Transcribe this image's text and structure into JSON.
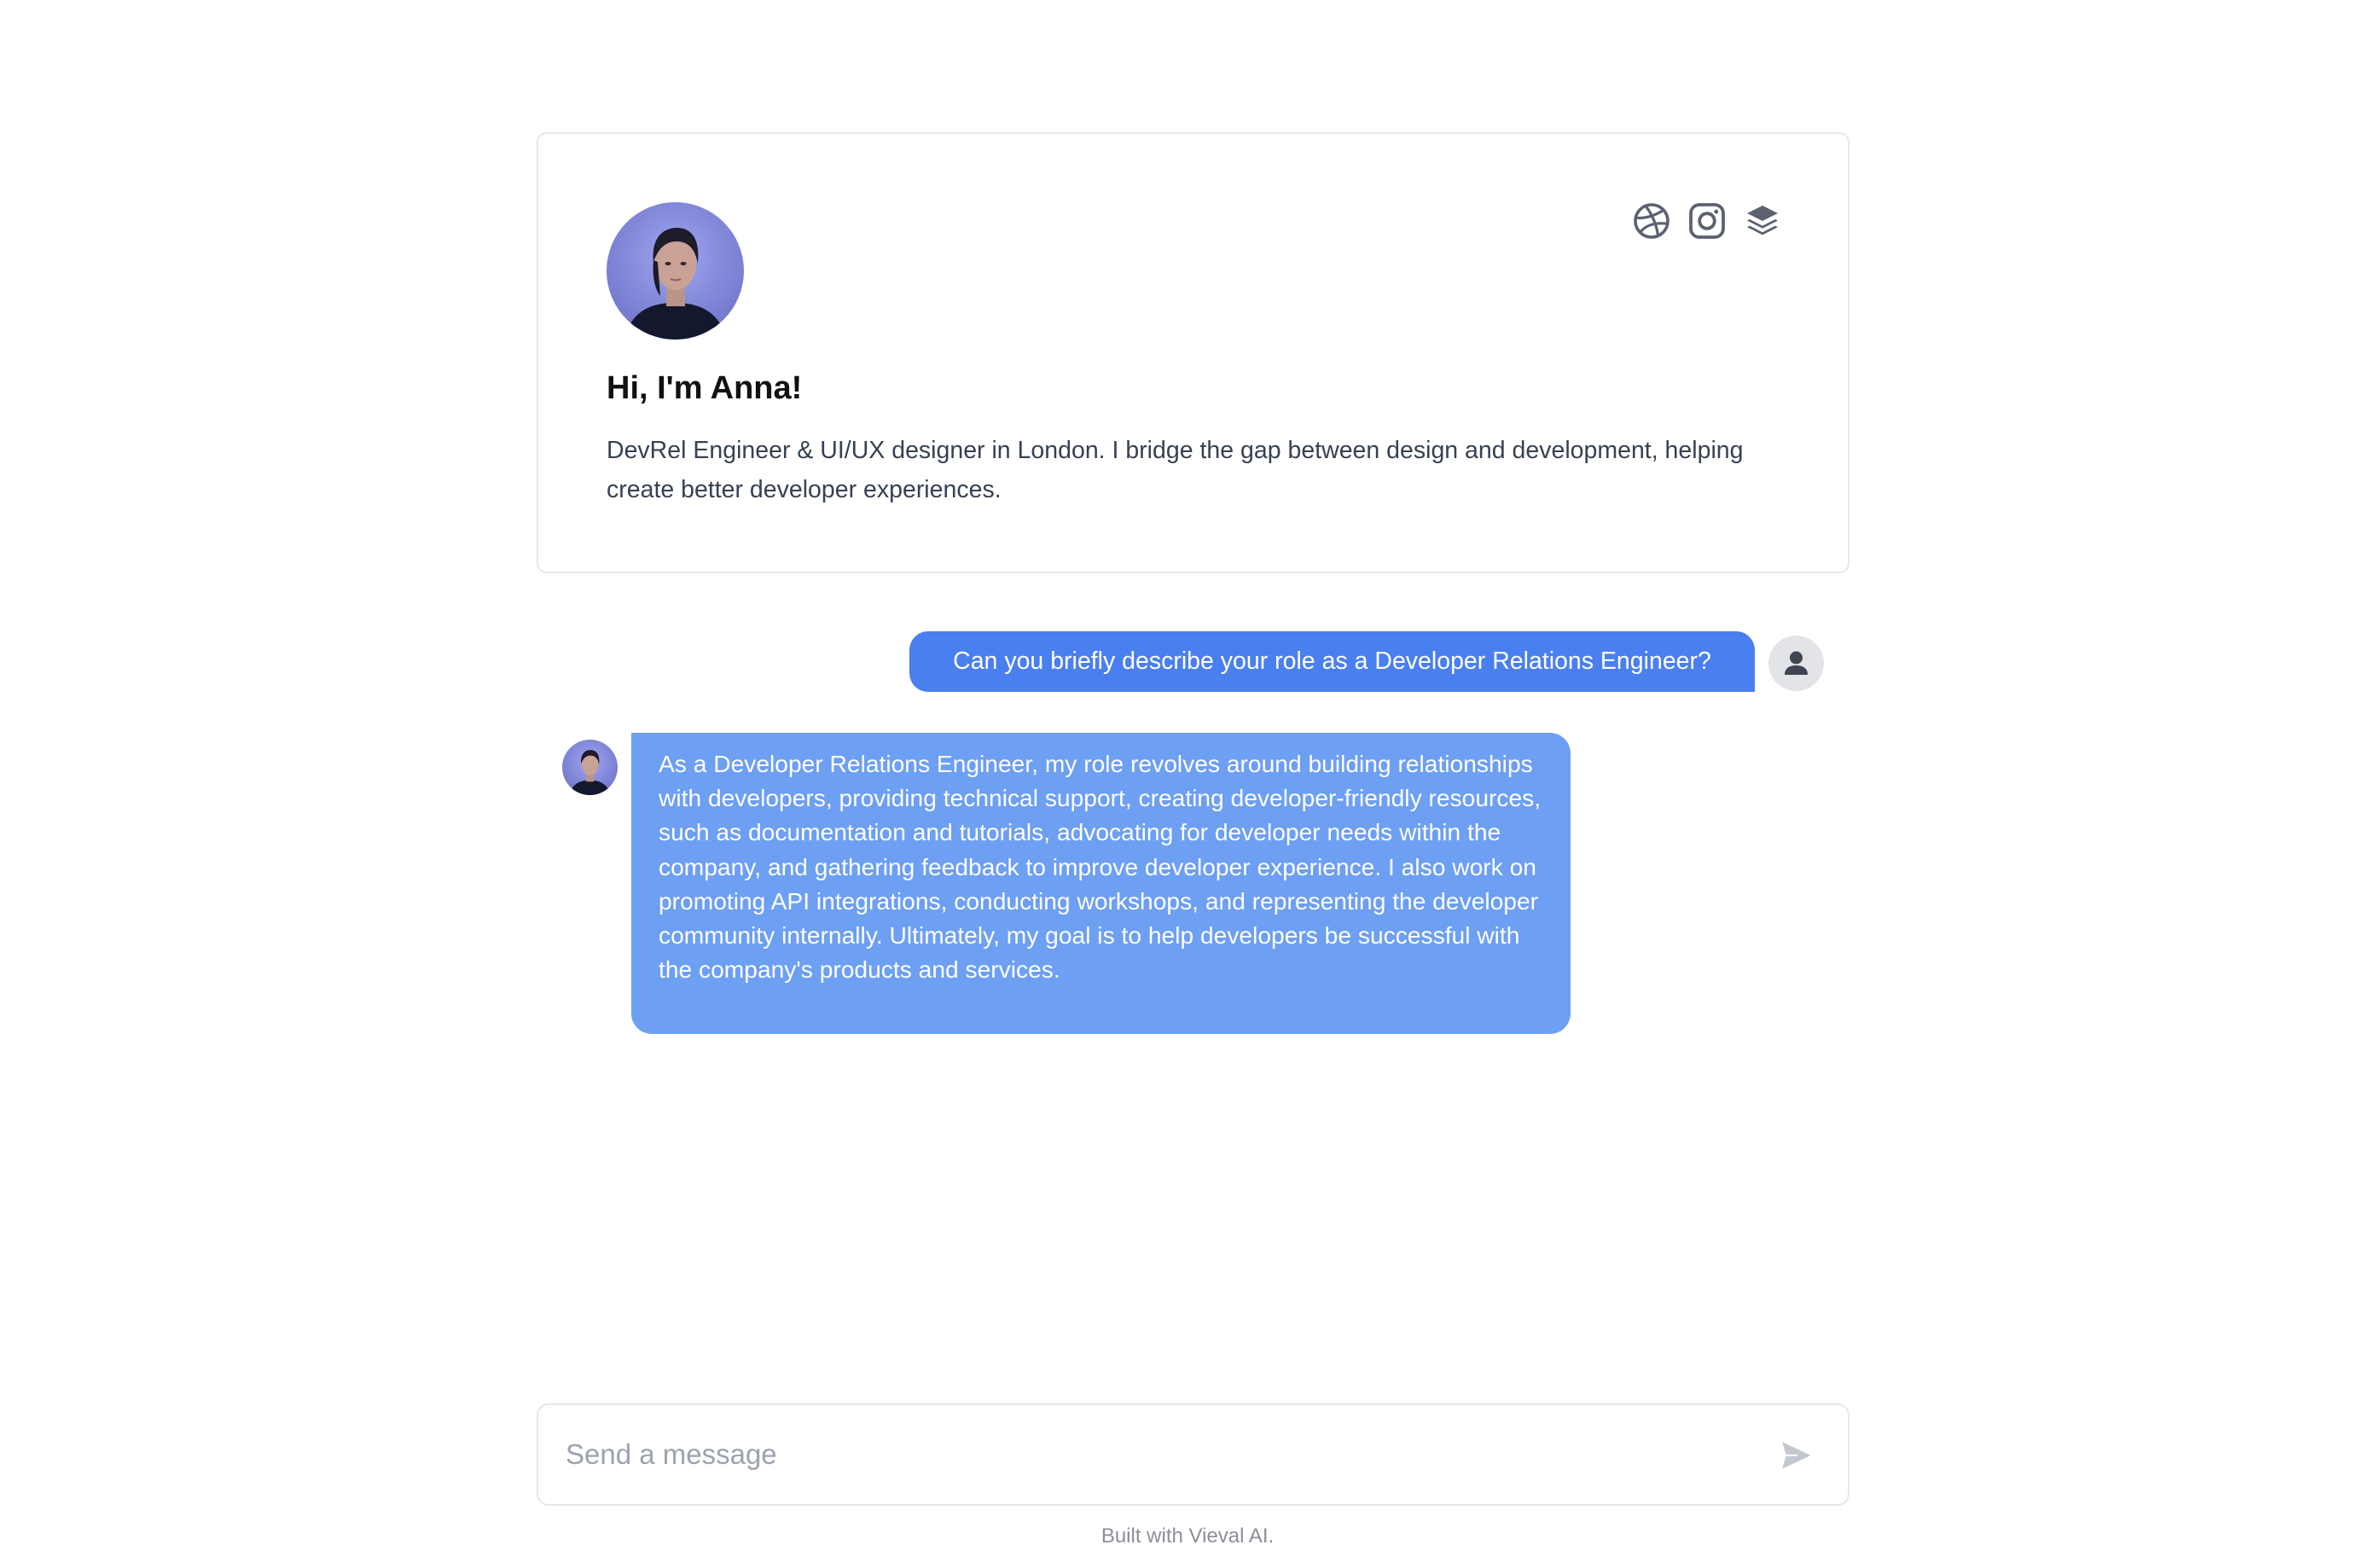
{
  "profile": {
    "greeting": "Hi, I'm Anna!",
    "bio": "DevRel Engineer & UI/UX designer in London. I bridge the gap between design and development, helping create better developer experiences.",
    "social_icons": [
      "dribbble-icon",
      "instagram-icon",
      "layers-icon"
    ]
  },
  "chat": {
    "user_message": "Can you briefly describe your role as a Developer Relations Engineer?",
    "bot_message": "As a Developer Relations Engineer, my role revolves around building relationships with developers, providing technical support, creating developer-friendly resources, such as documentation and tutorials, advocating for developer needs within the company, and gathering feedback to improve developer experience. I also work on promoting API integrations, conducting workshops, and representing the developer community internally. Ultimately, my goal is to help developers be successful with the company's products and services."
  },
  "composer": {
    "placeholder": "Send a message",
    "value": ""
  },
  "footer": {
    "text": "Built with Vieval AI."
  },
  "colors": {
    "user_bubble": "#4a7ff0",
    "bot_bubble": "#6d9ff2",
    "icon": "#5b6170"
  }
}
